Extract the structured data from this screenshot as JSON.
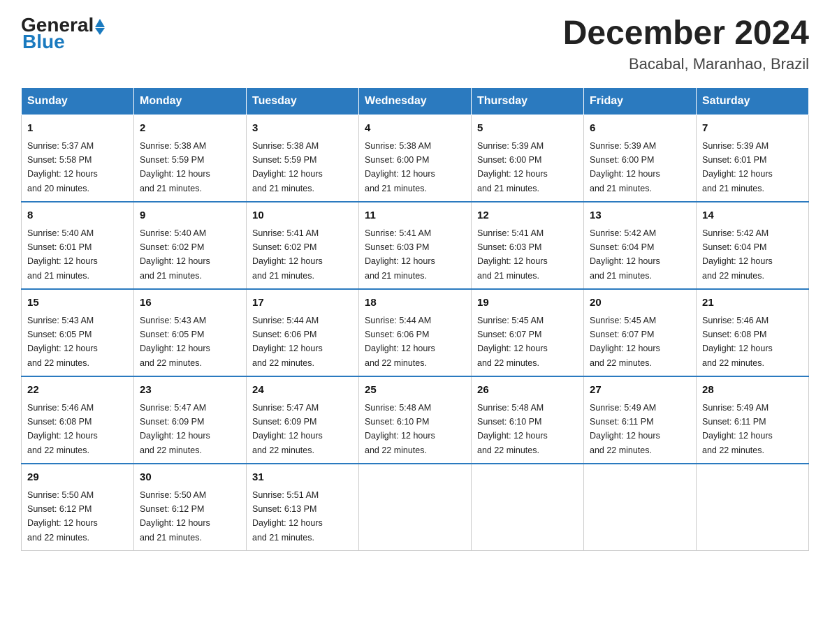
{
  "header": {
    "logo_general": "General",
    "logo_blue": "Blue",
    "month_title": "December 2024",
    "location": "Bacabal, Maranhao, Brazil"
  },
  "weekdays": [
    "Sunday",
    "Monday",
    "Tuesday",
    "Wednesday",
    "Thursday",
    "Friday",
    "Saturday"
  ],
  "weeks": [
    [
      {
        "day": "1",
        "sunrise": "5:37 AM",
        "sunset": "5:58 PM",
        "daylight": "12 hours and 20 minutes."
      },
      {
        "day": "2",
        "sunrise": "5:38 AM",
        "sunset": "5:59 PM",
        "daylight": "12 hours and 21 minutes."
      },
      {
        "day": "3",
        "sunrise": "5:38 AM",
        "sunset": "5:59 PM",
        "daylight": "12 hours and 21 minutes."
      },
      {
        "day": "4",
        "sunrise": "5:38 AM",
        "sunset": "6:00 PM",
        "daylight": "12 hours and 21 minutes."
      },
      {
        "day": "5",
        "sunrise": "5:39 AM",
        "sunset": "6:00 PM",
        "daylight": "12 hours and 21 minutes."
      },
      {
        "day": "6",
        "sunrise": "5:39 AM",
        "sunset": "6:00 PM",
        "daylight": "12 hours and 21 minutes."
      },
      {
        "day": "7",
        "sunrise": "5:39 AM",
        "sunset": "6:01 PM",
        "daylight": "12 hours and 21 minutes."
      }
    ],
    [
      {
        "day": "8",
        "sunrise": "5:40 AM",
        "sunset": "6:01 PM",
        "daylight": "12 hours and 21 minutes."
      },
      {
        "day": "9",
        "sunrise": "5:40 AM",
        "sunset": "6:02 PM",
        "daylight": "12 hours and 21 minutes."
      },
      {
        "day": "10",
        "sunrise": "5:41 AM",
        "sunset": "6:02 PM",
        "daylight": "12 hours and 21 minutes."
      },
      {
        "day": "11",
        "sunrise": "5:41 AM",
        "sunset": "6:03 PM",
        "daylight": "12 hours and 21 minutes."
      },
      {
        "day": "12",
        "sunrise": "5:41 AM",
        "sunset": "6:03 PM",
        "daylight": "12 hours and 21 minutes."
      },
      {
        "day": "13",
        "sunrise": "5:42 AM",
        "sunset": "6:04 PM",
        "daylight": "12 hours and 21 minutes."
      },
      {
        "day": "14",
        "sunrise": "5:42 AM",
        "sunset": "6:04 PM",
        "daylight": "12 hours and 22 minutes."
      }
    ],
    [
      {
        "day": "15",
        "sunrise": "5:43 AM",
        "sunset": "6:05 PM",
        "daylight": "12 hours and 22 minutes."
      },
      {
        "day": "16",
        "sunrise": "5:43 AM",
        "sunset": "6:05 PM",
        "daylight": "12 hours and 22 minutes."
      },
      {
        "day": "17",
        "sunrise": "5:44 AM",
        "sunset": "6:06 PM",
        "daylight": "12 hours and 22 minutes."
      },
      {
        "day": "18",
        "sunrise": "5:44 AM",
        "sunset": "6:06 PM",
        "daylight": "12 hours and 22 minutes."
      },
      {
        "day": "19",
        "sunrise": "5:45 AM",
        "sunset": "6:07 PM",
        "daylight": "12 hours and 22 minutes."
      },
      {
        "day": "20",
        "sunrise": "5:45 AM",
        "sunset": "6:07 PM",
        "daylight": "12 hours and 22 minutes."
      },
      {
        "day": "21",
        "sunrise": "5:46 AM",
        "sunset": "6:08 PM",
        "daylight": "12 hours and 22 minutes."
      }
    ],
    [
      {
        "day": "22",
        "sunrise": "5:46 AM",
        "sunset": "6:08 PM",
        "daylight": "12 hours and 22 minutes."
      },
      {
        "day": "23",
        "sunrise": "5:47 AM",
        "sunset": "6:09 PM",
        "daylight": "12 hours and 22 minutes."
      },
      {
        "day": "24",
        "sunrise": "5:47 AM",
        "sunset": "6:09 PM",
        "daylight": "12 hours and 22 minutes."
      },
      {
        "day": "25",
        "sunrise": "5:48 AM",
        "sunset": "6:10 PM",
        "daylight": "12 hours and 22 minutes."
      },
      {
        "day": "26",
        "sunrise": "5:48 AM",
        "sunset": "6:10 PM",
        "daylight": "12 hours and 22 minutes."
      },
      {
        "day": "27",
        "sunrise": "5:49 AM",
        "sunset": "6:11 PM",
        "daylight": "12 hours and 22 minutes."
      },
      {
        "day": "28",
        "sunrise": "5:49 AM",
        "sunset": "6:11 PM",
        "daylight": "12 hours and 22 minutes."
      }
    ],
    [
      {
        "day": "29",
        "sunrise": "5:50 AM",
        "sunset": "6:12 PM",
        "daylight": "12 hours and 22 minutes."
      },
      {
        "day": "30",
        "sunrise": "5:50 AM",
        "sunset": "6:12 PM",
        "daylight": "12 hours and 21 minutes."
      },
      {
        "day": "31",
        "sunrise": "5:51 AM",
        "sunset": "6:13 PM",
        "daylight": "12 hours and 21 minutes."
      },
      null,
      null,
      null,
      null
    ]
  ],
  "labels": {
    "sunrise": "Sunrise:",
    "sunset": "Sunset:",
    "daylight": "Daylight:"
  }
}
